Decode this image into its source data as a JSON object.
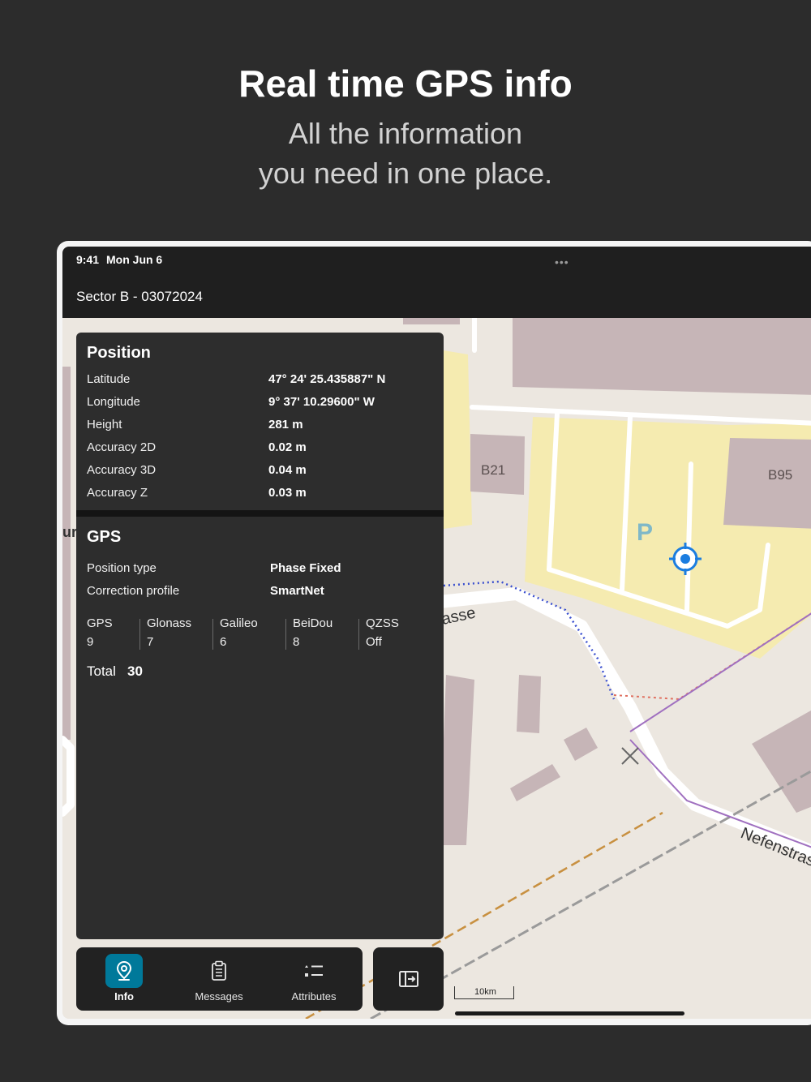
{
  "hero": {
    "title": "Real time GPS info",
    "subtitle_line1": "All the information",
    "subtitle_line2": "you need in one place."
  },
  "status_bar": {
    "time": "9:41",
    "date": "Mon Jun 6",
    "menu_dots": "•••"
  },
  "project": {
    "title": "Sector B - 03072024"
  },
  "position": {
    "title": "Position",
    "rows": [
      {
        "label": "Latitude",
        "value": "47° 24' 25.435887\" N"
      },
      {
        "label": "Longitude",
        "value": "9° 37' 10.29600\" W"
      },
      {
        "label": "Height",
        "value": "281 m"
      },
      {
        "label": "Accuracy 2D",
        "value": "0.02 m"
      },
      {
        "label": "Accuracy 3D",
        "value": "0.04 m"
      },
      {
        "label": "Accuracy Z",
        "value": "0.03 m"
      }
    ]
  },
  "gps": {
    "title": "GPS",
    "rows": [
      {
        "label": "Position type",
        "value": "Phase Fixed"
      },
      {
        "label": "Correction profile",
        "value": "SmartNet"
      }
    ],
    "constellations": [
      {
        "name": "GPS",
        "count": "9"
      },
      {
        "name": "Glonass",
        "count": "7"
      },
      {
        "name": "Galileo",
        "count": "6"
      },
      {
        "name": "BeiDou",
        "count": "8"
      },
      {
        "name": "QZSS",
        "count": "Off"
      }
    ],
    "total_label": "Total",
    "total_value": "30"
  },
  "map": {
    "labels": {
      "building_1": "B21",
      "building_2": "B95",
      "parking": "P",
      "street_1": "asse",
      "street_2": "Nefenstras",
      "edge_text": "ur H"
    },
    "scale": "10km",
    "colors": {
      "background": "#ece7e0",
      "building": "#c6b5b7",
      "parking_area": "#f5ebb0",
      "road": "#ffffff",
      "location_marker": "#1b7de0"
    }
  },
  "tabs": [
    {
      "label": "Info",
      "icon": "location-pin-icon",
      "active": true
    },
    {
      "label": "Messages",
      "icon": "clipboard-icon",
      "active": false
    },
    {
      "label": "Attributes",
      "icon": "attributes-list-icon",
      "active": false
    }
  ],
  "panel_toggle": {
    "icon": "panel-toggle-icon"
  },
  "colors": {
    "accent": "#00799a",
    "panel_bg": "#2d2d2d",
    "page_bg": "#2c2c2c"
  }
}
